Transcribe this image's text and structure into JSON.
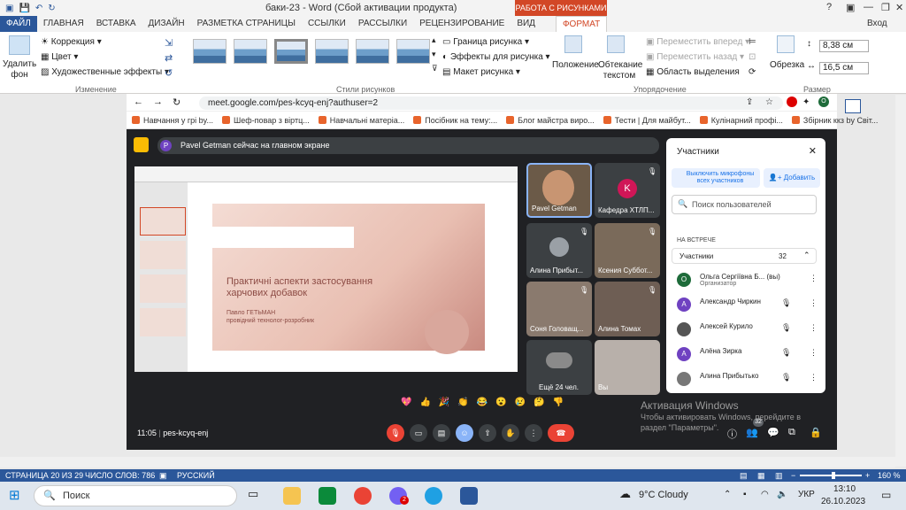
{
  "titlebar": {
    "doc_title": "баки-23 - Word (Сбой активации продукта)",
    "context_tab": "РАБОТА С РИСУНКАМИ",
    "help": "?",
    "login": "Вход"
  },
  "tabs": [
    "ФАЙЛ",
    "ГЛАВНАЯ",
    "ВСТАВКА",
    "ДИЗАЙН",
    "РАЗМЕТКА СТРАНИЦЫ",
    "ССЫЛКИ",
    "РАССЫЛКИ",
    "РЕЦЕНЗИРОВАНИЕ",
    "ВИД",
    "ФОРМАТ"
  ],
  "ribbon": {
    "remove_bg": "Удалить фон",
    "correction": "Коррекция",
    "color": "Цвет",
    "artistic": "Художественные эффекты",
    "group_change": "Изменение",
    "group_styles": "Стили рисунков",
    "border": "Граница рисунка",
    "effects": "Эффекты для рисунка",
    "layout": "Макет рисунка",
    "position": "Положение",
    "wrap": "Обтекание текстом",
    "forward": "Переместить вперед",
    "backward": "Переместить назад",
    "selection": "Область выделения",
    "group_arrange": "Упорядочение",
    "crop": "Обрезка",
    "height": "8,38 см",
    "width": "16,5 см",
    "group_size": "Размер"
  },
  "browser": {
    "url": "meet.google.com/pes-kcyq-enj?authuser=2",
    "bookmarks": [
      "Навчання у грі by...",
      "Шеф-повар з віртц...",
      "Навчальні матеріа...",
      "Посібник на тему:...",
      "Блог майстра виро...",
      "Тести | Для майбут...",
      "Кулінарний профі...",
      "Збірник ккз by Світ..."
    ]
  },
  "meet": {
    "banner": "Pavel Getman сейчас на главном экране",
    "banner_avatar": "P",
    "slide_title": "Практичні аспекти застосування харчових добавок",
    "slide_author": "Павло ГЕТЬМАН",
    "slide_role": "провідний технолог-розробник",
    "tiles": [
      {
        "name": "Pavel Getman"
      },
      {
        "name": "Кафедра ХТЛП...",
        "avatar": "K"
      },
      {
        "name": "Алина Прибыт..."
      },
      {
        "name": "Ксения Суббот..."
      },
      {
        "name": "Соня Головащ..."
      },
      {
        "name": "Алина Томах"
      },
      {
        "name": "Ещё 24 чел."
      },
      {
        "name": "Вы"
      }
    ],
    "time": "11:05",
    "meeting_code": "pes-kcyq-enj",
    "badge_count": "32",
    "reactions": [
      "💖",
      "👍",
      "🎉",
      "👏",
      "😂",
      "😮",
      "😢",
      "🤔",
      "👎"
    ]
  },
  "panel": {
    "title": "Участники",
    "mute_all": "Выключить микрофоны всех участников",
    "add": "Добавить",
    "search_placeholder": "Поиск пользователей",
    "section": "НА ВСТРЕЧЕ",
    "participants_label": "Участники",
    "participants_count": "32",
    "people": [
      {
        "name": "Ольга Сергіївна Б... (вы)",
        "role": "Организатор",
        "avatar": "О",
        "color": "#1e6b3a"
      },
      {
        "name": "Александр Чиркин",
        "role": "",
        "avatar": "А",
        "color": "#6f42c1"
      },
      {
        "name": "Алексей Курило",
        "role": "",
        "avatar": "",
        "color": "#555"
      },
      {
        "name": "Алёна Зирка",
        "role": "",
        "avatar": "А",
        "color": "#6f42c1"
      },
      {
        "name": "Алина Прибытько",
        "role": "",
        "avatar": "",
        "color": "#777"
      }
    ]
  },
  "watermark": {
    "title": "Активация Windows",
    "text": "Чтобы активировать Windows, перейдите в раздел \"Параметры\"."
  },
  "statusbar": {
    "page": "СТРАНИЦА 20 ИЗ 29",
    "words": "ЧИСЛО СЛОВ: 786",
    "lang": "РУССКИЙ",
    "zoom": "160 %"
  },
  "taskbar": {
    "search": "Поиск",
    "weather": "9°C  Cloudy",
    "lang": "УКР",
    "time": "13:10",
    "date": "26.10.2023",
    "viber_badge": "2"
  }
}
